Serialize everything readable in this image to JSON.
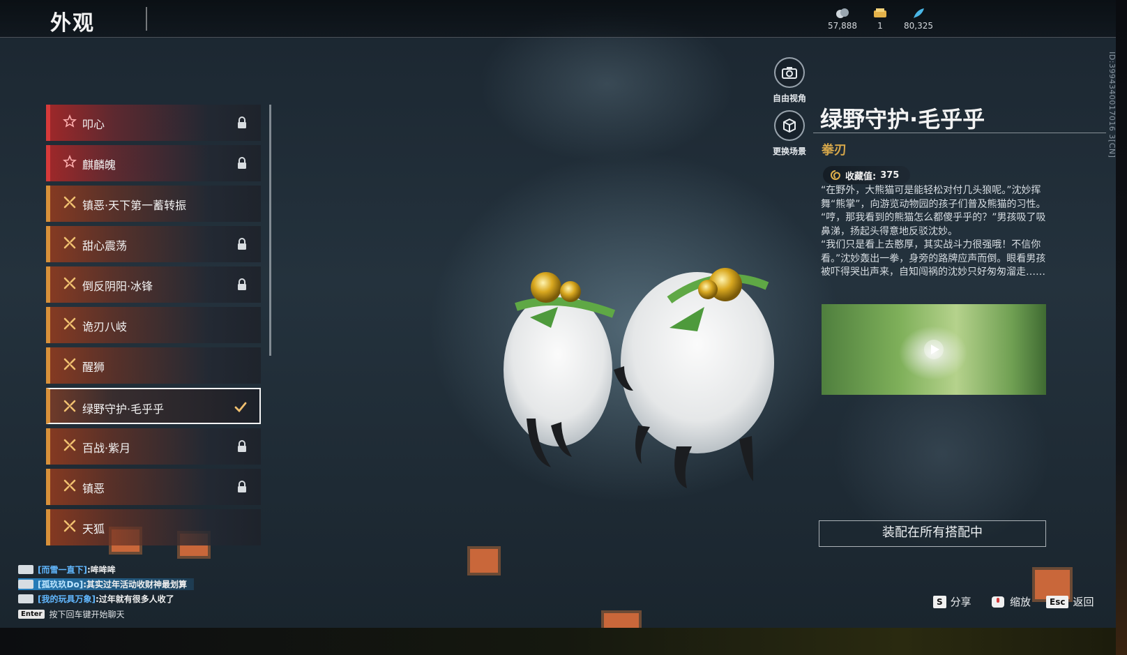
{
  "header": {
    "title": "外观",
    "currencies": [
      {
        "icon": "coin-stack-icon",
        "value": "57,888"
      },
      {
        "icon": "ticket-icon",
        "value": "1"
      },
      {
        "icon": "feather-icon",
        "value": "80,325"
      }
    ],
    "id_text": "ID:3994340017016 3[CN]"
  },
  "skins": [
    {
      "label": "叩心",
      "rarity": "red",
      "state": "locked"
    },
    {
      "label": "麒麟魄",
      "rarity": "red",
      "state": "locked"
    },
    {
      "label": "镇恶·天下第一蓄转振",
      "rarity": "gold",
      "state": "none"
    },
    {
      "label": "甜心震荡",
      "rarity": "gold",
      "state": "locked"
    },
    {
      "label": "倒反阴阳·冰锋",
      "rarity": "gold",
      "state": "locked"
    },
    {
      "label": "诡刃八岐",
      "rarity": "gold",
      "state": "none"
    },
    {
      "label": "醒狮",
      "rarity": "gold",
      "state": "none"
    },
    {
      "label": "绿野守护·毛乎乎",
      "rarity": "gold",
      "state": "equipped"
    },
    {
      "label": "百战·紫月",
      "rarity": "gold",
      "state": "locked"
    },
    {
      "label": "镇恶",
      "rarity": "gold",
      "state": "locked"
    },
    {
      "label": "天狐",
      "rarity": "gold",
      "state": "none"
    }
  ],
  "view_buttons": {
    "free_view": "自由视角",
    "change_scene": "更换场景"
  },
  "detail": {
    "name": "绿野守护·毛乎乎",
    "type": "拳刃",
    "collect_label": "收藏值:",
    "collect_value": "375",
    "description": [
      "“在野外，大熊猫可是能轻松对付几头狼呢。”沈妙挥舞“熊掌”，向游览动物园的孩子们普及熊猫的习性。",
      "“哼，那我看到的熊猫怎么都傻乎乎的？”男孩吸了吸鼻涕，扬起头得意地反驳沈妙。",
      "“我们只是看上去憨厚，其实战斗力很强哦！不信你看。”沈妙轰出一拳，身旁的路牌应声而倒。眼看男孩被吓得哭出声来，自知闯祸的沈妙只好匆匆溜走……"
    ],
    "equip_all_label": "装配在所有搭配中"
  },
  "footer_hints": {
    "share_key": "S",
    "share_label": "分享",
    "zoom_label": "缩放",
    "back_key": "Esc",
    "back_label": "返回"
  },
  "chat": {
    "lines": [
      {
        "name": "[而雪一直下]",
        "msg": ":哞哞哞"
      },
      {
        "name": "[孤玖玖Do]",
        "msg": ":其实过年活动收财神最划算"
      },
      {
        "name": "[我的玩具万象]",
        "msg": ":过年就有很多人收了"
      }
    ],
    "enter_key": "Enter",
    "hint": "按下回车键开始聊天"
  },
  "colors": {
    "accent_gold": "#d5a64a",
    "rarity_red": "#d63a3a",
    "rarity_gold": "#d8913a",
    "chat_name": "#62b8ff"
  }
}
